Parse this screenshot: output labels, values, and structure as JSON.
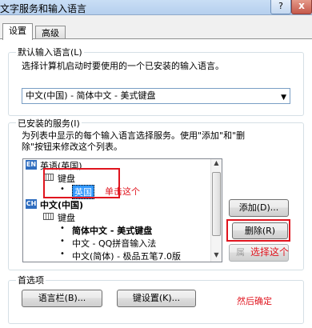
{
  "window": {
    "title": "文字服务和输入语言",
    "help_label": "?",
    "close_label": "x"
  },
  "tabs": [
    {
      "label": "设置"
    },
    {
      "label": "高级"
    }
  ],
  "default_lang": {
    "group_label": "默认输入语言(L)",
    "description": "选择计算机启动时要使用的一个已安装的输入语言。",
    "selected": "中文(中国) - 简体中文 - 美式键盘"
  },
  "services": {
    "group_label": "已安装的服务(I)",
    "description_line1": "为列表中显示的每个输入语言选择服务。使用\"添加\"和\"删",
    "description_line2": "除\"按钮来修改这个列表。",
    "tree": {
      "lang1": {
        "icon": "EN",
        "label": "英语(英国)",
        "category": "键盘",
        "item": "英国"
      },
      "lang2": {
        "icon": "CH",
        "label": "中文(中国)",
        "category": "键盘",
        "items": [
          "简体中文 - 美式键盘",
          "中文 - QQ拼音输入法",
          "中文(简体) - 极品五笔7.0版"
        ]
      }
    },
    "buttons": {
      "add": "添加(D)...",
      "remove": "删除(R)",
      "properties": "属"
    }
  },
  "preferences": {
    "group_label": "首选项",
    "language_bar": "语言栏(B)...",
    "key_settings": "键设置(K)..."
  },
  "annotations": {
    "click_this": "单击这个",
    "select_this": "选择这个",
    "then_ok": "然后确定"
  }
}
